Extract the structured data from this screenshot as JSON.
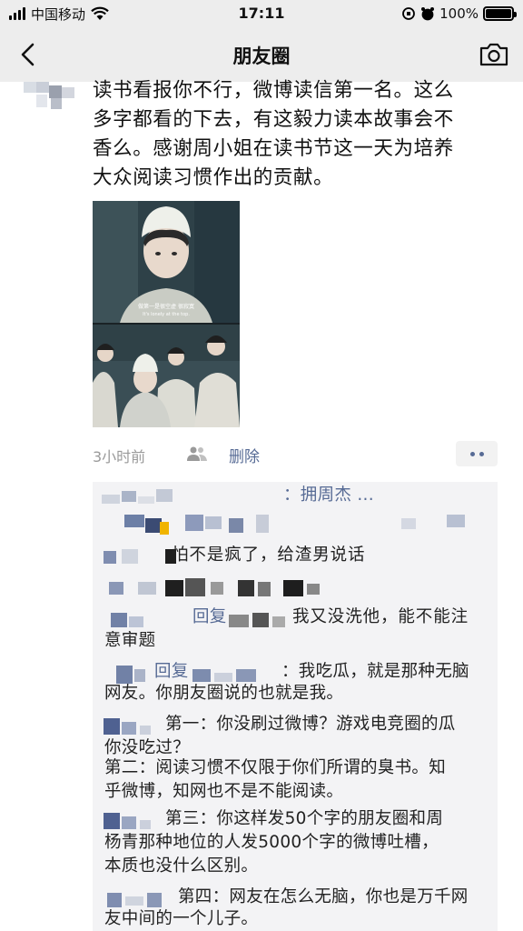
{
  "status_bar": {
    "carrier": "中国移动",
    "time": "17:11",
    "battery": "100%"
  },
  "nav": {
    "title": "朋友圈",
    "back_icon": "chevron-left-icon",
    "camera_icon": "camera-icon"
  },
  "post": {
    "lines": [
      "读书看报你不行，微博读信第一名。这么",
      "多字都看的下去，有这毅力读本故事会不",
      "香么。感谢周小姐在读书节这一天为培养",
      "大众阅读习惯作出的贡献。"
    ],
    "time": "3小时前",
    "delete_label": "删除",
    "photo_subtitles": [
      "做第一是很空虚 很寂寞",
      "It's lonely at the top."
    ]
  },
  "comments": [
    {
      "text": "：拥周杰 ..."
    },
    {
      "text": "怕不是疯了，给渣男说话"
    },
    {
      "text": "回复"
    },
    {
      "text": "我又没洗他，能不能注"
    },
    {
      "text": "意审题"
    },
    {
      "text": "回复"
    },
    {
      "text": "：我吃瓜，就是那种无脑"
    },
    {
      "text": "网友。你朋友圈说的也就是我。"
    },
    {
      "text": "第一：你没刷过微博？游戏电竞圈的瓜"
    },
    {
      "text": "你没吃过？"
    },
    {
      "text": "第二：阅读习惯不仅限于你们所谓的臭书。知"
    },
    {
      "text": "乎微博，知网也不是不能阅读。"
    },
    {
      "text": "第三：你这样发50个字的朋友圈和周"
    },
    {
      "text": "杨青那种地位的人发5000个字的微博吐槽，"
    },
    {
      "text": "本质也没什么区别。"
    },
    {
      "text": "第四：网友在怎么无脑，你也是万千网"
    },
    {
      "text": "友中间的一个儿子。"
    }
  ],
  "colors": {
    "link": "#576b95",
    "meta_gray": "#9a9a9a",
    "comment_bg": "#f3f3f5",
    "bar_bg": "#ededed"
  }
}
